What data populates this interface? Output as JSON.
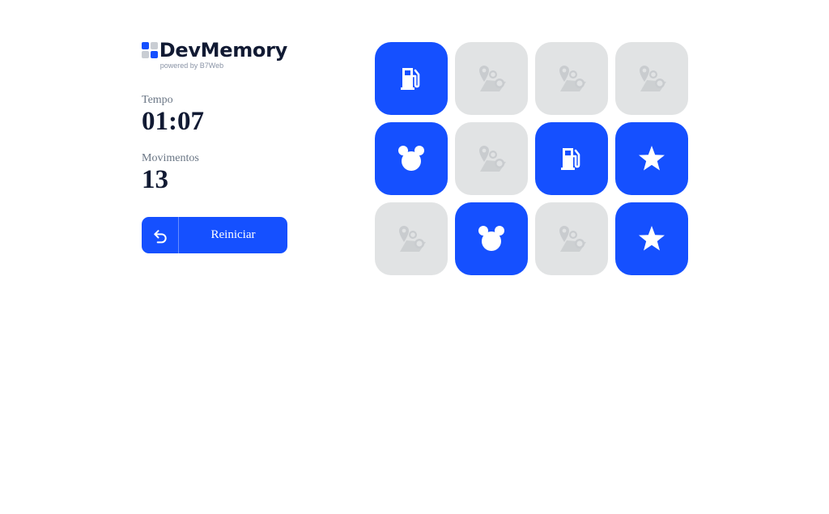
{
  "brand": {
    "title": "DevMemory",
    "subtitle": "powered by B7Web"
  },
  "stats": {
    "time_label": "Tempo",
    "time_value": "01:07",
    "moves_label": "Movimentos",
    "moves_value": "13"
  },
  "restart": {
    "label": "Reiniciar",
    "icon": "undo-arrow-icon"
  },
  "colors": {
    "accent": "#1550ff",
    "card_hidden": "#e1e3e4",
    "text_dark": "#111a33"
  },
  "grid": {
    "columns": 4,
    "cards": [
      {
        "state": "revealed",
        "icon": "gas-pump-icon"
      },
      {
        "state": "hidden",
        "icon": "map-pin-icon"
      },
      {
        "state": "hidden",
        "icon": "map-pin-icon"
      },
      {
        "state": "hidden",
        "icon": "map-pin-icon"
      },
      {
        "state": "revealed",
        "icon": "mickey-mouse-icon"
      },
      {
        "state": "hidden",
        "icon": "map-pin-icon"
      },
      {
        "state": "revealed",
        "icon": "gas-pump-icon"
      },
      {
        "state": "revealed",
        "icon": "star-icon"
      },
      {
        "state": "hidden",
        "icon": "map-pin-icon"
      },
      {
        "state": "revealed",
        "icon": "mickey-mouse-icon"
      },
      {
        "state": "hidden",
        "icon": "map-pin-icon"
      },
      {
        "state": "revealed",
        "icon": "star-icon"
      }
    ]
  }
}
